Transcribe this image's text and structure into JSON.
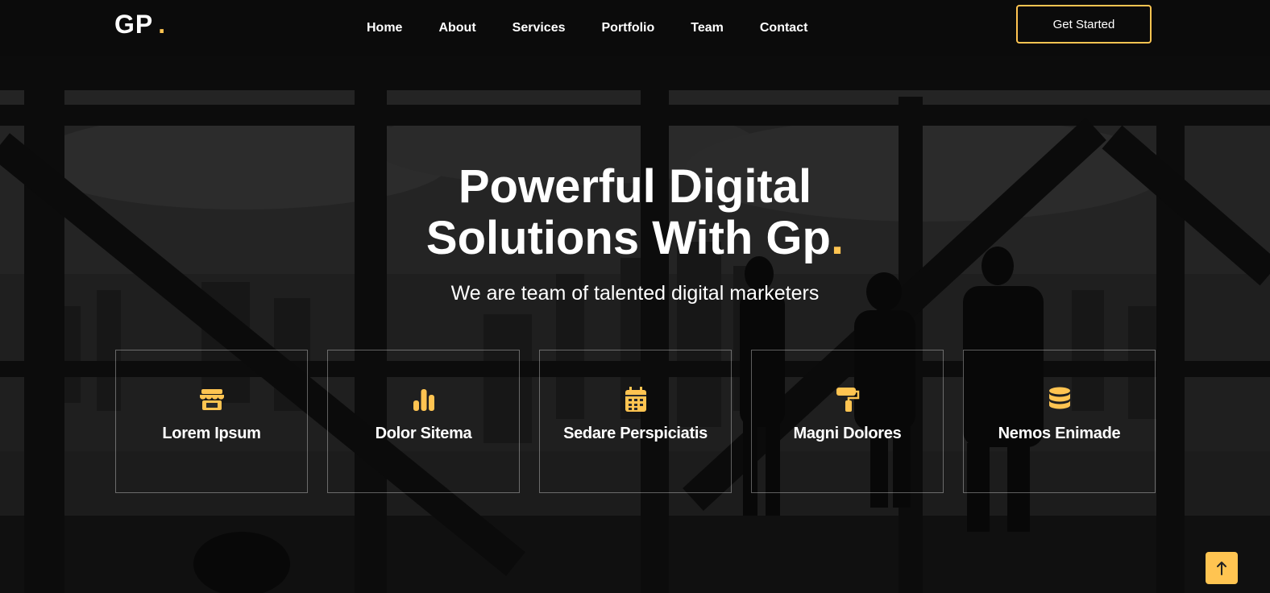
{
  "logo": {
    "text": "GP",
    "dot": "."
  },
  "nav": {
    "items": [
      {
        "label": "Home"
      },
      {
        "label": "About"
      },
      {
        "label": "Services"
      },
      {
        "label": "Portfolio"
      },
      {
        "label": "Team"
      },
      {
        "label": "Contact"
      }
    ]
  },
  "header": {
    "cta_label": "Get Started"
  },
  "hero": {
    "title_line1": "Powerful Digital",
    "title_line2": "Solutions With Gp",
    "title_dot": ".",
    "subtitle": "We are team of talented digital marketers"
  },
  "features": [
    {
      "label": "Lorem Ipsum",
      "icon": "store-icon"
    },
    {
      "label": "Dolor Sitema",
      "icon": "bar-chart-icon"
    },
    {
      "label": "Sedare Perspiciatis",
      "icon": "calendar-icon"
    },
    {
      "label": "Magni Dolores",
      "icon": "paint-roller-icon"
    },
    {
      "label": "Nemos Enimade",
      "icon": "database-icon"
    }
  ],
  "back_to_top": {
    "icon": "arrow-up-icon"
  },
  "colors": {
    "accent": "#ffc451",
    "background": "#151515",
    "text": "#ffffff"
  }
}
